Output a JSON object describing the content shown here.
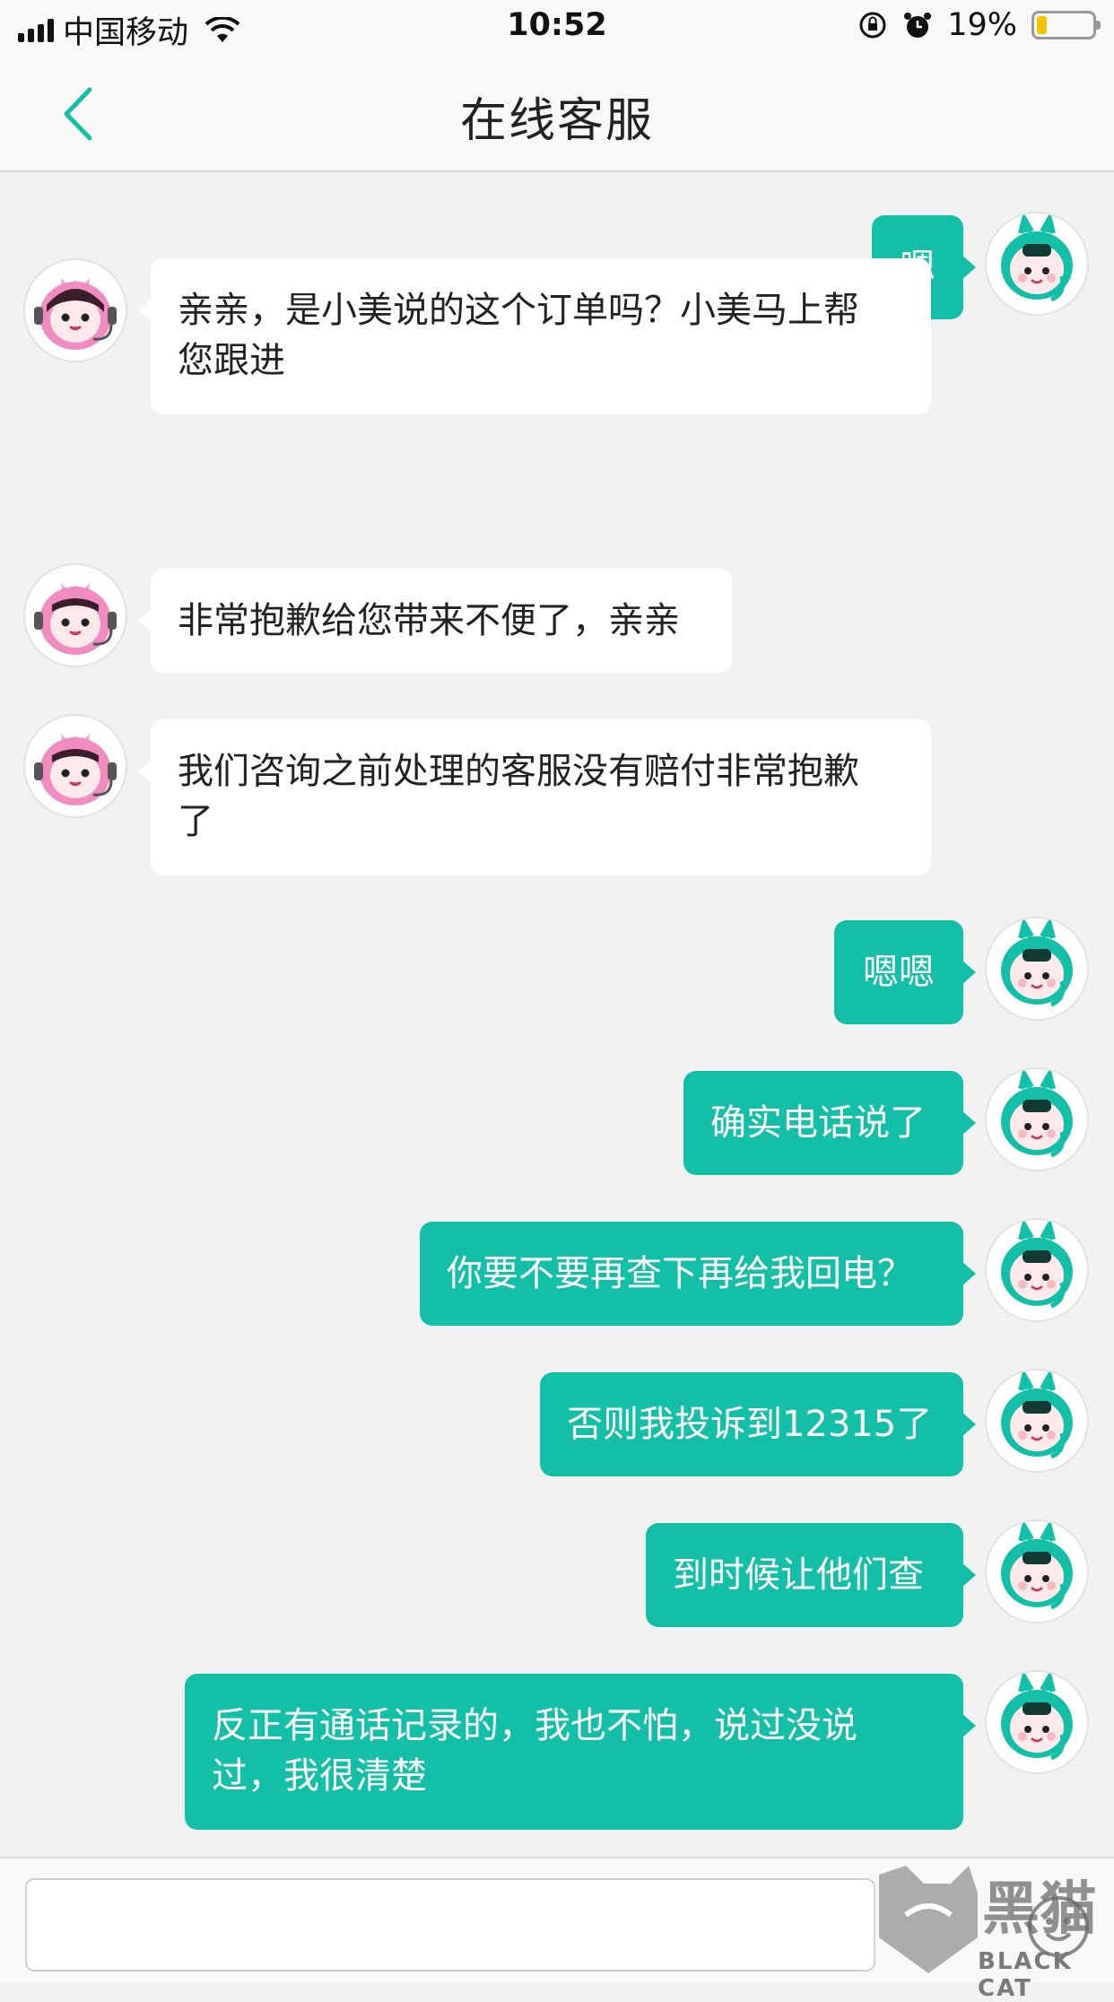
{
  "status_bar": {
    "carrier": "中国移动",
    "time": "10:52",
    "battery_percent": "19%",
    "battery_level": 0.19,
    "icons": [
      "signal-icon",
      "wifi-icon",
      "rotation-lock-icon",
      "alarm-icon",
      "battery-icon"
    ]
  },
  "nav": {
    "title": "在线客服",
    "back_icon": "chevron-left-icon"
  },
  "colors": {
    "accent": "#13c0a7",
    "outgoing_bubble": "#13c0a7",
    "incoming_bubble": "#ffffff",
    "background": "#f2f2f2"
  },
  "messages": [
    {
      "side": "out",
      "lines": [
        "嗯"
      ]
    },
    {
      "side": "in",
      "lines": [
        "亲亲，是小美说的这个订单吗？小美马上帮",
        "您跟进"
      ]
    },
    {
      "side": "in",
      "lines": [
        "非常抱歉给您带来不便了，亲亲"
      ]
    },
    {
      "side": "in",
      "lines": [
        "我们咨询之前处理的客服没有赔付非常抱歉",
        "了"
      ]
    },
    {
      "side": "out",
      "lines": [
        "嗯嗯"
      ]
    },
    {
      "side": "out",
      "lines": [
        "确实电话说了"
      ]
    },
    {
      "side": "out",
      "lines": [
        "你要不要再查下再给我回电？"
      ]
    },
    {
      "side": "out",
      "lines": [
        "否则我投诉到12315了"
      ]
    },
    {
      "side": "out",
      "lines": [
        "到时候让他们查"
      ]
    },
    {
      "side": "out",
      "lines": [
        "反正有通话记录的，我也不怕，说过没说",
        "过，我很清楚"
      ]
    }
  ],
  "input": {
    "value": "",
    "placeholder": ""
  },
  "watermark": {
    "logo_text": "黑猫",
    "brand": "BLACK CAT"
  }
}
